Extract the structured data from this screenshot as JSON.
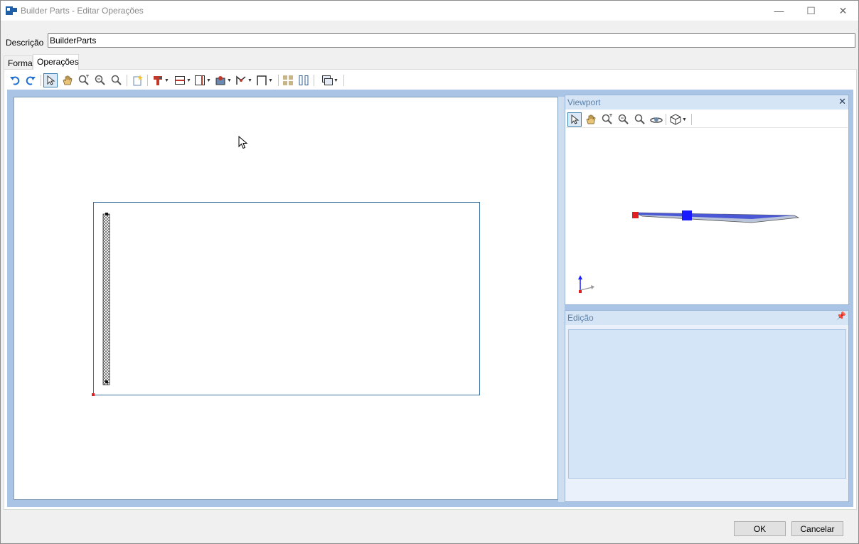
{
  "window": {
    "title": "Builder Parts - Editar Operações",
    "controls": {
      "minimize": "—",
      "maximize": "☐",
      "close": "✕"
    }
  },
  "description": {
    "label": "Descrição",
    "value": "BuilderParts"
  },
  "tabs": [
    {
      "label": "Forma",
      "selected": false
    },
    {
      "label": "Operações",
      "selected": true
    }
  ],
  "toolbar": {
    "items": [
      "undo-icon",
      "redo-icon",
      "select-pointer-icon",
      "pan-hand-icon",
      "zoom-extents-icon",
      "zoom-window-icon",
      "zoom-icon",
      "new-page-icon",
      "drill-icon",
      "cut-horizontal-icon",
      "cut-vertical-icon",
      "edge-band-icon",
      "routing-icon",
      "frame-icon",
      "grid-icon",
      "split-icon",
      "view-options-icon"
    ]
  },
  "viewport": {
    "title": "Viewport",
    "close_label": "✕",
    "toolbar": [
      "select-pointer-icon",
      "pan-hand-icon",
      "zoom-extents-icon",
      "zoom-window-icon",
      "zoom-icon",
      "orbit-icon",
      "view-cube-icon"
    ],
    "colors": {
      "red_marker": "#e02020",
      "blue_marker": "#1a1aff"
    }
  },
  "edicao": {
    "title": "Edição",
    "pin_label": "📌"
  },
  "buttons": {
    "ok": "OK",
    "cancel": "Cancelar"
  },
  "colors": {
    "accent": "#3b6f9e",
    "workarea_bg": "#a9c4e4",
    "panel_header": "#d6e5f5"
  }
}
